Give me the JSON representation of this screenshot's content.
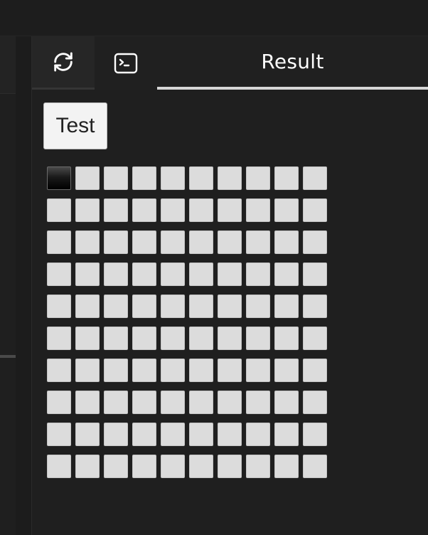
{
  "tabs": {
    "refresh_icon": "refresh-icon",
    "console_icon": "terminal-icon",
    "result_label": "Result"
  },
  "main": {
    "test_button_label": "Test"
  },
  "grid": {
    "rows": 10,
    "cols": 10,
    "active_cells": [
      [
        0,
        0
      ]
    ],
    "cell_color": "#dcdcdc",
    "active_color": "#000000"
  },
  "colors": {
    "background": "#1e1e1e",
    "tab_underline": "#d6d6d6",
    "text": "#ffffff"
  }
}
